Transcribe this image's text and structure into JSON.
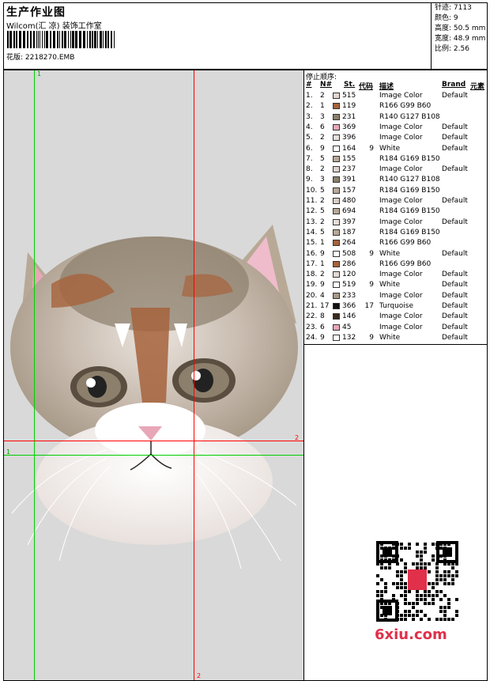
{
  "header": {
    "title": "生产作业图",
    "subtitle": "Wilcom(汇 凉) 装饰工作室",
    "file_label": "花版: 2218270.EMB"
  },
  "stats": [
    {
      "label": "针迹:",
      "value": "7113"
    },
    {
      "label": "颜色:",
      "value": "9"
    },
    {
      "label": "高度:",
      "value": "50.5 mm"
    },
    {
      "label": "宽度:",
      "value": "48.9 mm"
    },
    {
      "label": "比例:",
      "value": "2.56"
    }
  ],
  "guides": {
    "vertical_tag": "2",
    "horizontal_tag": "2",
    "green_tag": "1",
    "green_tag_left": "1"
  },
  "list": {
    "heading": "停止顺序:",
    "columns": {
      "num": "#",
      "n": "N#",
      "st": "St.",
      "code": "代码",
      "desc": "描述",
      "brand": "Brand",
      "elem": "元素"
    },
    "rows": [
      {
        "num": "1.",
        "n": "2",
        "st": "515",
        "code": "",
        "desc": "Image Color",
        "brand": "Default",
        "color": "#e5d6cf"
      },
      {
        "num": "2.",
        "n": "1",
        "st": "119",
        "code": "",
        "desc": "R166 G99 B60",
        "brand": "",
        "color": "#a6633c"
      },
      {
        "num": "3.",
        "n": "3",
        "st": "231",
        "code": "",
        "desc": "R140 G127 B108",
        "brand": "",
        "color": "#8c7f6c"
      },
      {
        "num": "4.",
        "n": "6",
        "st": "369",
        "code": "",
        "desc": "Image Color",
        "brand": "Default",
        "color": "#e8a7b7"
      },
      {
        "num": "5.",
        "n": "2",
        "st": "396",
        "code": "",
        "desc": "Image Color",
        "brand": "Default",
        "color": "#e6e1dc"
      },
      {
        "num": "6.",
        "n": "9",
        "st": "164",
        "code": "9",
        "desc": "White",
        "brand": "Default",
        "color": "#ffffff"
      },
      {
        "num": "7.",
        "n": "5",
        "st": "155",
        "code": "",
        "desc": "R184 G169 B150",
        "brand": "",
        "color": "#b8a996"
      },
      {
        "num": "8.",
        "n": "2",
        "st": "237",
        "code": "",
        "desc": "Image Color",
        "brand": "Default",
        "color": "#ddd2cd"
      },
      {
        "num": "9.",
        "n": "3",
        "st": "391",
        "code": "",
        "desc": "R140 G127 B108",
        "brand": "",
        "color": "#8c7f6c"
      },
      {
        "num": "10.",
        "n": "5",
        "st": "157",
        "code": "",
        "desc": "R184 G169 B150",
        "brand": "",
        "color": "#b8a996"
      },
      {
        "num": "11.",
        "n": "2",
        "st": "480",
        "code": "",
        "desc": "Image Color",
        "brand": "Default",
        "color": "#d9cec6"
      },
      {
        "num": "12.",
        "n": "5",
        "st": "694",
        "code": "",
        "desc": "R184 G169 B150",
        "brand": "",
        "color": "#b8a996"
      },
      {
        "num": "13.",
        "n": "2",
        "st": "397",
        "code": "",
        "desc": "Image Color",
        "brand": "Default",
        "color": "#e8ddd6"
      },
      {
        "num": "14.",
        "n": "5",
        "st": "187",
        "code": "",
        "desc": "R184 G169 B150",
        "brand": "",
        "color": "#b8a996"
      },
      {
        "num": "15.",
        "n": "1",
        "st": "264",
        "code": "",
        "desc": "R166 G99 B60",
        "brand": "",
        "color": "#a6633c"
      },
      {
        "num": "16.",
        "n": "9",
        "st": "508",
        "code": "9",
        "desc": "White",
        "brand": "Default",
        "color": "#ffffff"
      },
      {
        "num": "17.",
        "n": "1",
        "st": "286",
        "code": "",
        "desc": "R166 G99 B60",
        "brand": "",
        "color": "#a6633c"
      },
      {
        "num": "18.",
        "n": "2",
        "st": "120",
        "code": "",
        "desc": "Image Color",
        "brand": "Default",
        "color": "#e3d9d3"
      },
      {
        "num": "19.",
        "n": "9",
        "st": "519",
        "code": "9",
        "desc": "White",
        "brand": "Default",
        "color": "#ffffff"
      },
      {
        "num": "20.",
        "n": "4",
        "st": "233",
        "code": "",
        "desc": "Image Color",
        "brand": "Default",
        "color": "#a89a88"
      },
      {
        "num": "21.",
        "n": "17",
        "st": "366",
        "code": "17",
        "desc": "Turquoise",
        "brand": "Default",
        "color": "#111111"
      },
      {
        "num": "22.",
        "n": "8",
        "st": "146",
        "code": "",
        "desc": "Image Color",
        "brand": "Default",
        "color": "#3a2a1c"
      },
      {
        "num": "23.",
        "n": "6",
        "st": "45",
        "code": "",
        "desc": "Image Color",
        "brand": "Default",
        "color": "#e8a7b7"
      },
      {
        "num": "24.",
        "n": "9",
        "st": "132",
        "code": "9",
        "desc": "White",
        "brand": "Default",
        "color": "#ffffff"
      }
    ]
  },
  "watermark": {
    "text": "6xiu.com"
  },
  "colors": {
    "guide_red": "#ff0000",
    "guide_green": "#00d000",
    "preview_bg": "#d9d9d9"
  }
}
